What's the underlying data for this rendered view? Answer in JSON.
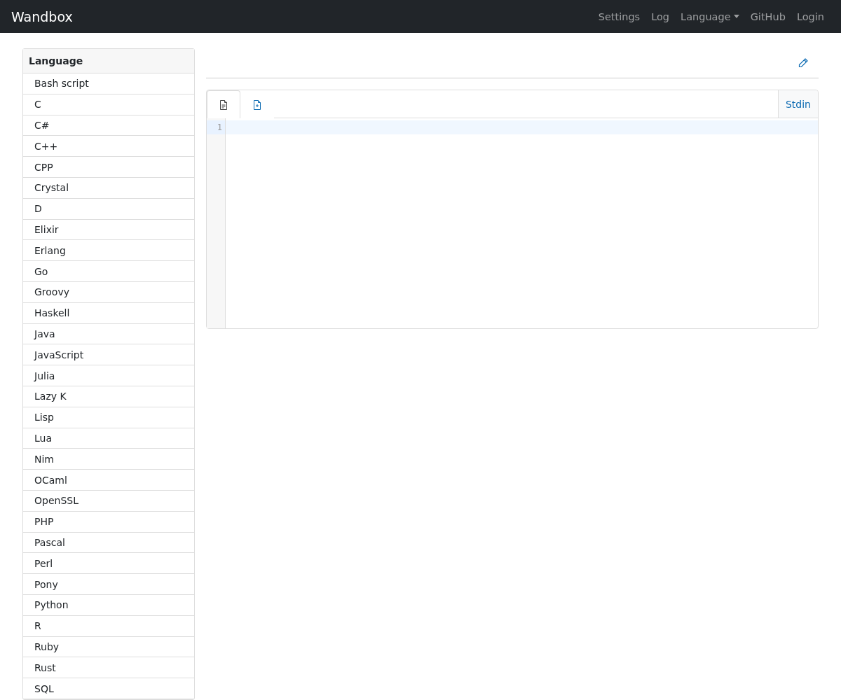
{
  "navbar": {
    "brand": "Wandbox",
    "links": [
      {
        "label": "Settings",
        "kind": "link"
      },
      {
        "label": "Log",
        "kind": "link"
      },
      {
        "label": "Language",
        "kind": "dropdown"
      },
      {
        "label": "GitHub",
        "kind": "link"
      },
      {
        "label": "Login",
        "kind": "link"
      }
    ]
  },
  "sidebar": {
    "title": "Language",
    "items": [
      "Bash script",
      "C",
      "C#",
      "C++",
      "CPP",
      "Crystal",
      "D",
      "Elixir",
      "Erlang",
      "Go",
      "Groovy",
      "Haskell",
      "Java",
      "JavaScript",
      "Julia",
      "Lazy K",
      "Lisp",
      "Lua",
      "Nim",
      "OCaml",
      "OpenSSL",
      "PHP",
      "Pascal",
      "Perl",
      "Pony",
      "Python",
      "R",
      "Ruby",
      "Rust",
      "SQL"
    ]
  },
  "editor": {
    "tabs": [
      {
        "kind": "file",
        "selected": true
      },
      {
        "kind": "add",
        "selected": false
      }
    ],
    "stdin_tab": "Stdin",
    "line_numbers": [
      "1"
    ]
  }
}
